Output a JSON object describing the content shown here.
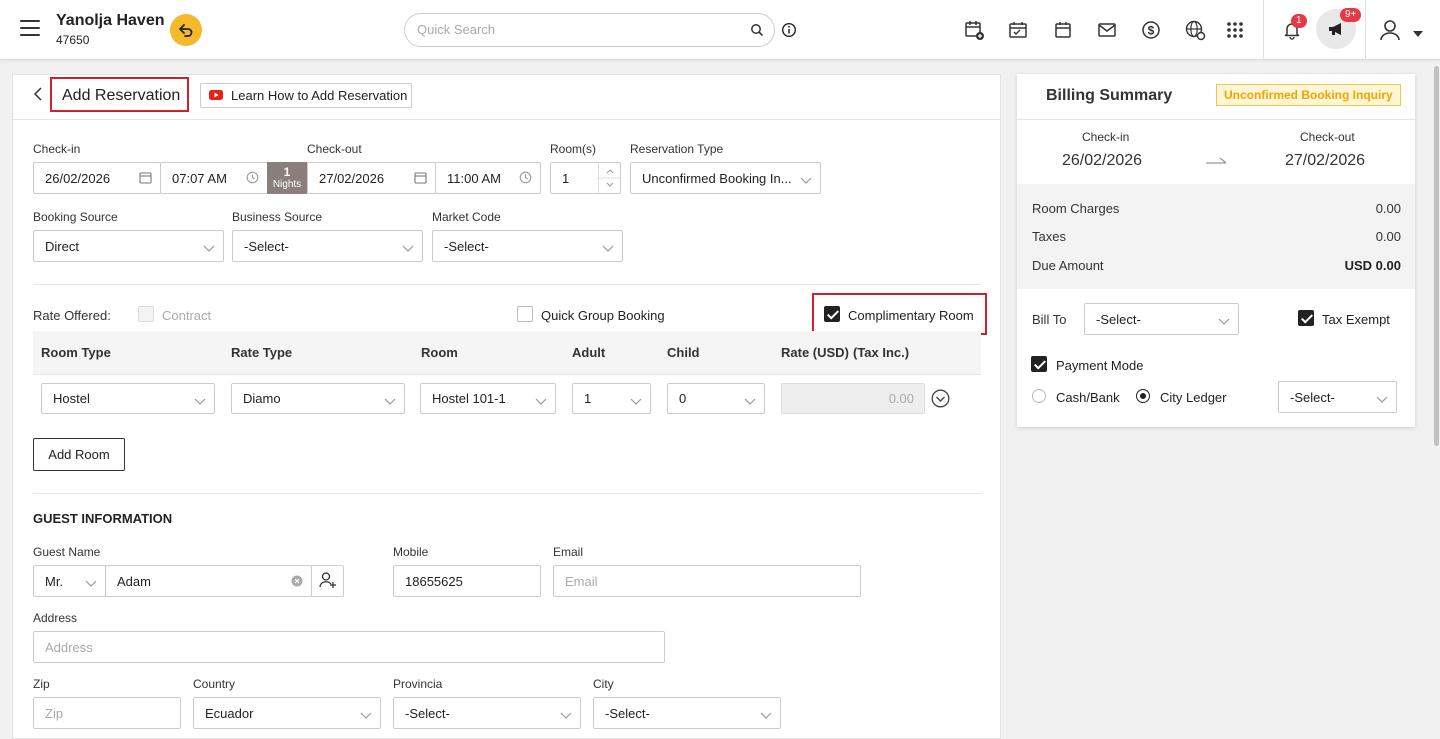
{
  "header": {
    "hotel_name": "Yanolja Haven",
    "hotel_id": "47650",
    "search_placeholder": "Quick Search",
    "notification_count": "1",
    "announcement_count": "9+"
  },
  "page": {
    "back_label": "<",
    "title": "Add Reservation",
    "learn_link": "Learn How to Add Reservation"
  },
  "stay": {
    "checkin_label": "Check-in",
    "checkin_date": "26/02/2026",
    "checkin_time": "07:07 AM",
    "nights_count": "1",
    "nights_label": "Nights",
    "checkout_label": "Check-out",
    "checkout_date": "27/02/2026",
    "checkout_time": "11:00 AM",
    "rooms_label": "Room(s)",
    "rooms_value": "1",
    "res_type_label": "Reservation Type",
    "res_type_value": "Unconfirmed Booking In..."
  },
  "source": {
    "booking_source_label": "Booking Source",
    "booking_source_value": "Direct",
    "business_source_label": "Business Source",
    "business_source_value": "-Select-",
    "market_code_label": "Market Code",
    "market_code_value": "-Select-"
  },
  "rate": {
    "rate_offered_label": "Rate Offered:",
    "contract_label": "Contract",
    "quick_group_label": "Quick Group Booking",
    "complimentary_label": "Complimentary Room"
  },
  "room_table": {
    "headers": [
      "Room Type",
      "Rate Type",
      "Room",
      "Adult",
      "Child",
      "Rate (USD)",
      "(Tax Inc.)"
    ],
    "row": {
      "room_type": "Hostel",
      "rate_type": "Diamo",
      "room": "Hostel 101-1",
      "adult": "1",
      "child": "0",
      "rate": "0.00"
    },
    "add_room_label": "Add Room"
  },
  "guest": {
    "section_title": "GUEST INFORMATION",
    "name_label": "Guest Name",
    "salutation": "Mr.",
    "name_value": "Adam",
    "mobile_label": "Mobile",
    "mobile_value": "18655625",
    "email_label": "Email",
    "email_placeholder": "Email",
    "address_label": "Address",
    "address_placeholder": "Address",
    "zip_label": "Zip",
    "zip_placeholder": "Zip",
    "country_label": "Country",
    "country_value": "Ecuador",
    "province_label": "Provincia",
    "province_value": "-Select-",
    "city_label": "City",
    "city_value": "-Select-"
  },
  "billing": {
    "title": "Billing Summary",
    "status_badge": "Unconfirmed Booking Inquiry",
    "checkin_label": "Check-in",
    "checkin_date": "26/02/2026",
    "checkout_label": "Check-out",
    "checkout_date": "27/02/2026",
    "room_charges_label": "Room Charges",
    "room_charges_value": "0.00",
    "taxes_label": "Taxes",
    "taxes_value": "0.00",
    "due_label": "Due Amount",
    "due_value": "USD 0.00",
    "bill_to_label": "Bill To",
    "bill_to_value": "-Select-",
    "tax_exempt_label": "Tax Exempt",
    "payment_mode_label": "Payment Mode",
    "cash_bank_label": "Cash/Bank",
    "city_ledger_label": "City Ledger",
    "ledger_select_value": "-Select-"
  },
  "colors": {
    "accent_yellow": "#f5b92b",
    "highlight_red": "#d0202a",
    "badge_red": "#e63946",
    "nights_bg": "#8a7f7a"
  }
}
